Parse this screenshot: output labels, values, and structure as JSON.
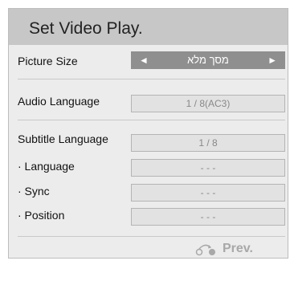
{
  "title": "Set Video Play.",
  "picture_size": {
    "label": "Picture Size",
    "value": "מסך מלא",
    "left_arrow": "◄",
    "right_arrow": "►"
  },
  "audio_language": {
    "label": "Audio Language",
    "value": "1 / 8(AC3)"
  },
  "subtitle_language": {
    "label": "Subtitle Language",
    "value": "1 / 8"
  },
  "language": {
    "label": "· Language",
    "value": "- - -"
  },
  "sync": {
    "label": "· Sync",
    "value": "- - -"
  },
  "position": {
    "label": "· Position",
    "value": "- - -"
  },
  "footer": {
    "prev_label": "Prev.",
    "prev_icon": "back-remote-icon"
  }
}
